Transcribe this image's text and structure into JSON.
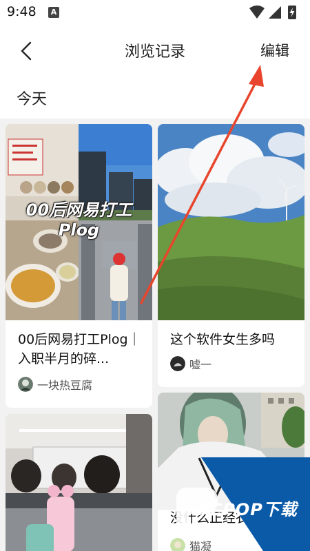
{
  "status_bar": {
    "time": "9:48",
    "notification_icon": "A"
  },
  "header": {
    "title": "浏览记录",
    "edit_label": "编辑"
  },
  "date_group": {
    "label": "今天"
  },
  "cards": [
    {
      "title": "00后网易打工Plog｜入职半月的碎...",
      "author": "一块热豆腐",
      "image_text_line1": "00后网易打工",
      "image_text_line2": "Plog"
    },
    {
      "title": "这个软件女生多吗",
      "author": "嘘一"
    },
    {
      "title": ""
    },
    {
      "title": "没什么正经衣服",
      "author": "猫凝"
    }
  ],
  "watermark": {
    "text": "PCPOP下载"
  },
  "colors": {
    "annotation_arrow": "#e8452c",
    "watermark_blue": "#0a5aa8"
  }
}
